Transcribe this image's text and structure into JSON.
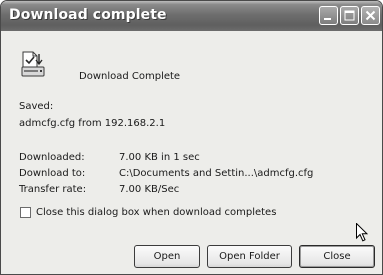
{
  "window": {
    "title": "Download complete"
  },
  "header": {
    "heading": "Download Complete",
    "icon": "file-download-icon"
  },
  "saved": {
    "label": "Saved:",
    "value": "admcfg.cfg from 192.168.2.1"
  },
  "details": {
    "downloaded_label": "Downloaded:",
    "downloaded_value": "7.00 KB in 1 sec",
    "download_to_label": "Download to:",
    "download_to_value": "C:\\Documents and Settin...\\admcfg.cfg",
    "transfer_rate_label": "Transfer rate:",
    "transfer_rate_value": "7.00 KB/Sec"
  },
  "options": {
    "close_when_done_label": "Close this dialog box when download completes",
    "close_when_done_checked": false
  },
  "buttons": {
    "open": "Open",
    "open_folder": "Open Folder",
    "close": "Close"
  },
  "colors": {
    "titlebar": "#6e6e6e",
    "client_background": "#ededea"
  }
}
